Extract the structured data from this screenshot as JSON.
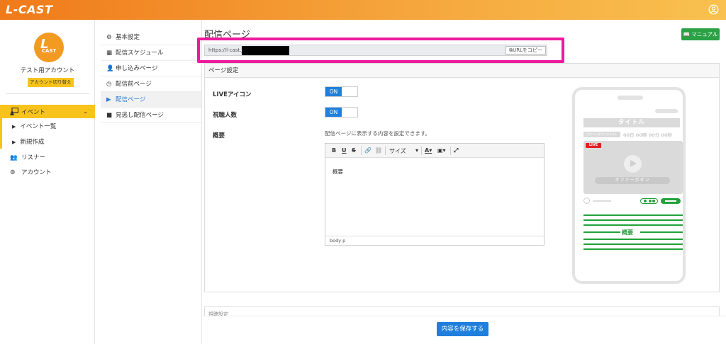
{
  "app": {
    "logo": "L-CAST"
  },
  "sidebar": {
    "avatar_text": "CAST",
    "avatar_letter": "L",
    "account_name": "テスト用アカウント",
    "switch_label": "アカウント切り替え",
    "event_label": "イベント",
    "event_sub": [
      "イベント一覧",
      "新規作成"
    ],
    "listener_label": "リスナー",
    "account_label": "アカウント"
  },
  "submenu": {
    "items": [
      "基本設定",
      "配信スケジュール",
      "申し込みページ",
      "配信前ページ",
      "配信ページ",
      "見逃し配信ページ"
    ],
    "active_index": 4
  },
  "main": {
    "title": "配信ページ",
    "manual_label": "マニュアル",
    "url_prefix": "https://l-cast.jp",
    "copy_label": "URLをコピー",
    "card_title": "ページ設定",
    "live_icon_label": "LIVEアイコン",
    "live_icon_state": "ON",
    "viewer_count_label": "視聴人数",
    "viewer_count_state": "ON",
    "summary_label": "概要",
    "summary_help": "配信ページに表示する内容を設定できます。",
    "editor": {
      "bold": "B",
      "underline": "U",
      "strike": "S",
      "size_label": "サイズ",
      "body_text": "概要",
      "path": "body  p"
    },
    "next_card_title": "視聴設定",
    "save_label": "内容を保存する"
  },
  "phone": {
    "title": "タイトル",
    "countdown_label": "カウントダウンテキスト",
    "timer": "00日 00時 00分 00秒",
    "live_badge": "LIVE",
    "offer_button": "オファーボタン",
    "summary": "概要"
  },
  "colors": {
    "accent_orange": "#f5a53c",
    "highlight": "#ee1a9e",
    "primary": "#1f7fdd",
    "green": "#21a13a",
    "event_yellow": "#f7c31c"
  }
}
